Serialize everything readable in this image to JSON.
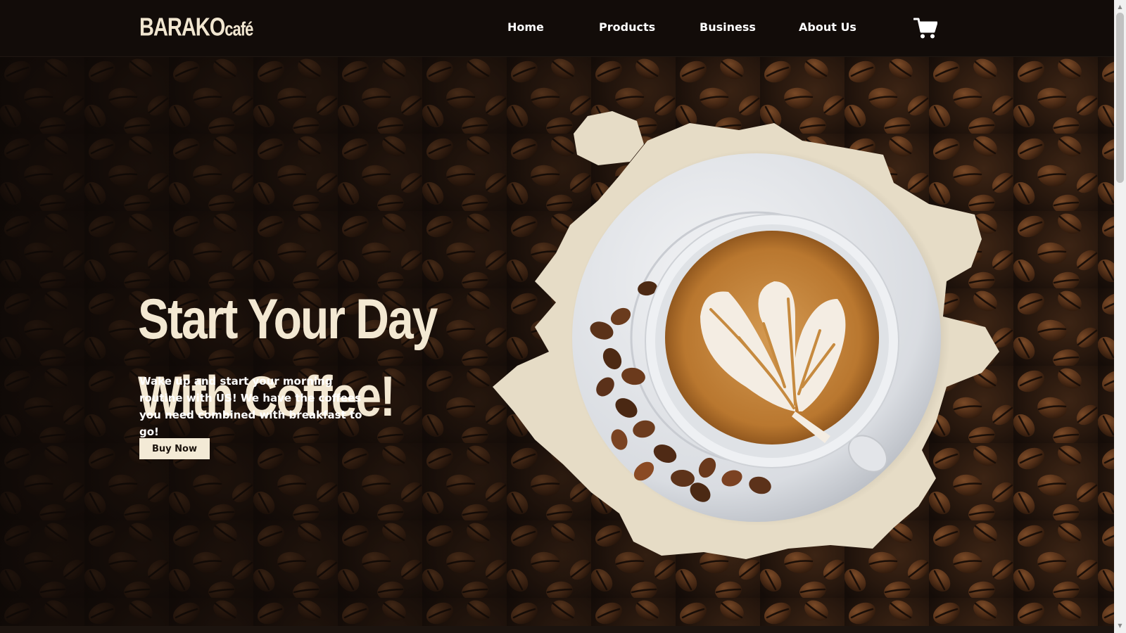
{
  "brand": {
    "name_main": "BARAKO",
    "name_suffix": "café"
  },
  "nav": {
    "links": [
      "Home",
      "Products",
      "Business",
      "About Us"
    ],
    "cart_icon": "shopping-cart-icon"
  },
  "hero": {
    "headline_line1": "Start Your Day",
    "headline_line2": "With Coffee!",
    "description": "Wake up and start your morning routine with US! We have the coffees you need combined with breakfast to go!",
    "button_label": "Buy Now",
    "image": "latte-art-coffee-cup-on-saucer"
  },
  "colors": {
    "nav_background": "#120c09",
    "headline": "#f3e8d2",
    "button_background": "#f3ead6",
    "splash": "#e6dcc6",
    "coffee_crema": "#c68a3f"
  }
}
